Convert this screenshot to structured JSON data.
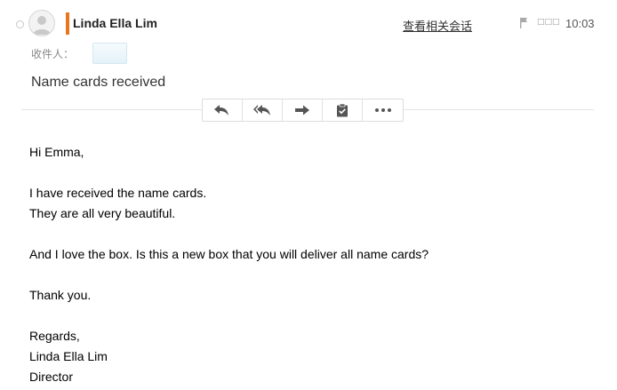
{
  "header": {
    "sender_name": "Linda Ella Lim",
    "related_link": "查看相关会话",
    "squares": "□□□",
    "time": "10:03",
    "to_label": "收件人："
  },
  "subject": "Name cards received",
  "toolbar": {
    "buttons": [
      {
        "icon": "reply-icon"
      },
      {
        "icon": "reply-all-icon"
      },
      {
        "icon": "forward-icon"
      },
      {
        "icon": "clipboard-check-icon"
      },
      {
        "icon": "more-icon"
      }
    ]
  },
  "body": {
    "lines": [
      "Hi Emma,",
      "",
      "I have received the name cards.",
      "They are all very beautiful.",
      "",
      "And I love the box. Is this a new box that you will deliver all name cards?",
      "",
      "Thank you.",
      "",
      "Regards,",
      "Linda Ella Lim",
      "Director"
    ]
  },
  "colors": {
    "accent_bar": "#e8761e",
    "icon": "#555555"
  }
}
